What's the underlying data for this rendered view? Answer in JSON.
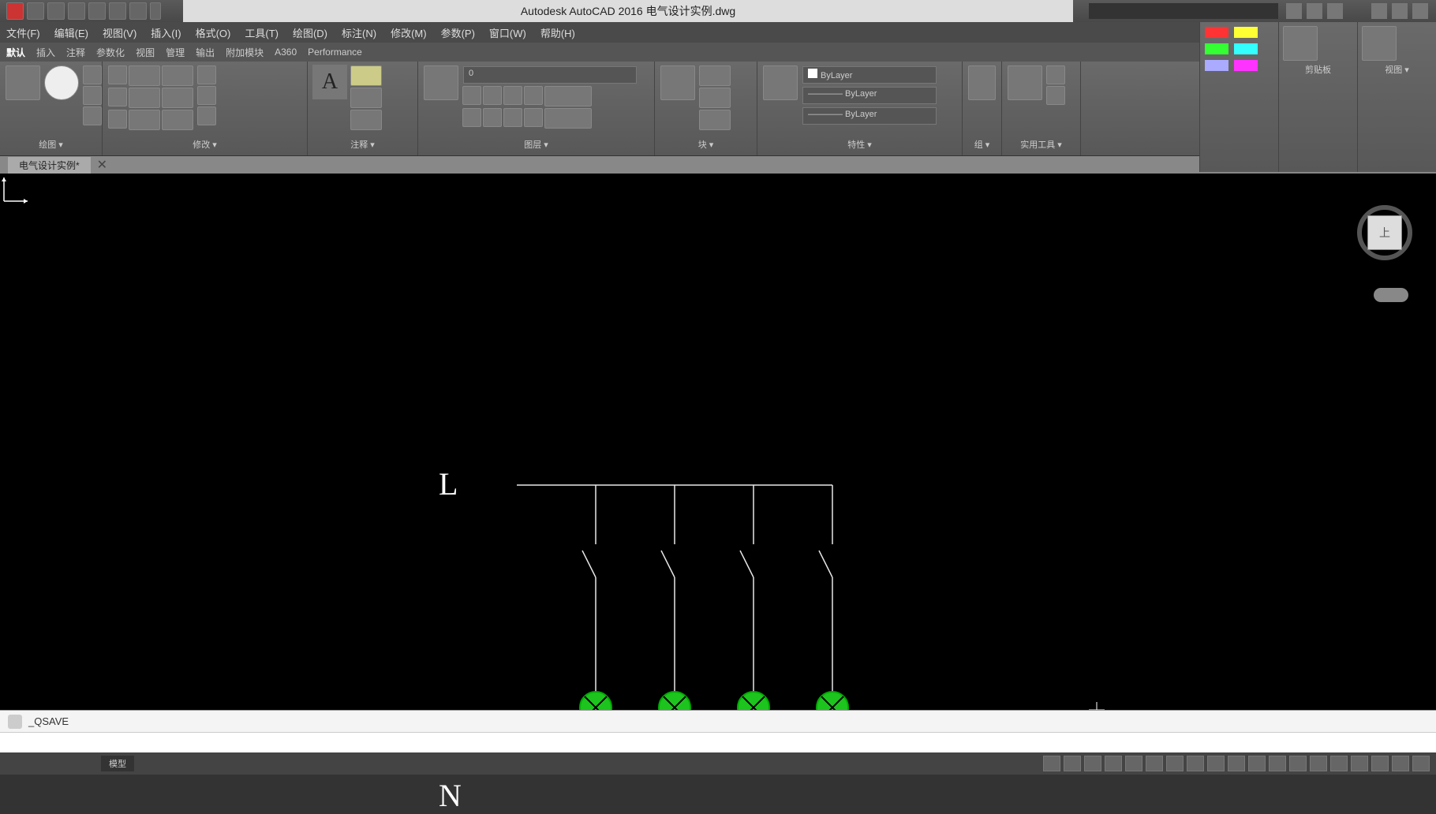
{
  "title": "Autodesk AutoCAD 2016   电气设计实例.dwg",
  "menu": [
    "文件(F)",
    "编辑(E)",
    "视图(V)",
    "插入(I)",
    "格式(O)",
    "工具(T)",
    "绘图(D)",
    "标注(N)",
    "修改(M)",
    "参数(P)",
    "窗口(W)",
    "帮助(H)"
  ],
  "tabs": [
    "默认",
    "插入",
    "注释",
    "参数化",
    "视图",
    "管理",
    "输出",
    "附加模块",
    "A360",
    "Performance"
  ],
  "panels": {
    "draw": "绘图 ▾",
    "modify": "修改 ▾",
    "annot": "注释 ▾",
    "layer": "图层 ▾",
    "block": "块 ▾",
    "prop": "特性 ▾",
    "group": "组 ▾",
    "util": "实用工具 ▾",
    "clip": "剪贴板",
    "view": "视图 ▾"
  },
  "layer_dd": "0",
  "prop_dd1": "ByLayer",
  "prop_dd2": "———— ByLayer",
  "prop_dd3": "———— ByLayer",
  "filetab": "电气设计实例*",
  "cube": "上",
  "drawing": {
    "L": "L",
    "N": "N"
  },
  "cmd": "_QSAVE",
  "model": "模型"
}
